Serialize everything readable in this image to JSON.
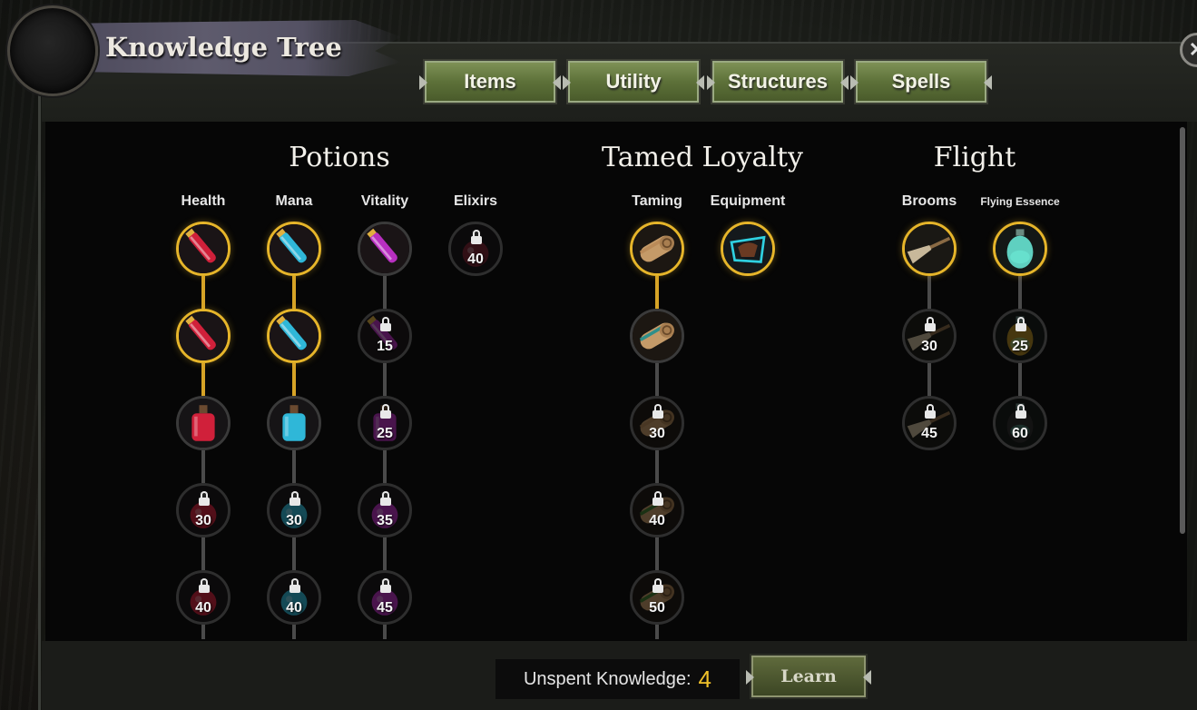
{
  "window": {
    "title": "Knowledge Tree",
    "close_icon": "x-icon"
  },
  "tabs": [
    {
      "label": "Items",
      "active": false
    },
    {
      "label": "Utility",
      "active": false
    },
    {
      "label": "Structures",
      "active": false
    },
    {
      "label": "Spells",
      "active": false
    }
  ],
  "categories": [
    {
      "title": "Potions",
      "columns": [
        {
          "label": "Health",
          "nodes": [
            {
              "icon": "health-potion-large-icon",
              "state": "unlocked",
              "level": ""
            },
            {
              "icon": "health-potion-vial-icon",
              "state": "unlocked",
              "level": ""
            },
            {
              "icon": "health-potion-bottle-icon",
              "state": "learnable",
              "level": ""
            },
            {
              "icon": "health-potion-round-icon",
              "state": "locked",
              "level": "30"
            },
            {
              "icon": "health-potion-flask-icon",
              "state": "locked",
              "level": "40"
            }
          ]
        },
        {
          "label": "Mana",
          "nodes": [
            {
              "icon": "mana-potion-large-icon",
              "state": "unlocked",
              "level": ""
            },
            {
              "icon": "mana-potion-vial-icon",
              "state": "unlocked",
              "level": ""
            },
            {
              "icon": "mana-potion-bottle-icon",
              "state": "learnable",
              "level": ""
            },
            {
              "icon": "mana-potion-round-icon",
              "state": "locked",
              "level": "30"
            },
            {
              "icon": "mana-potion-flask-icon",
              "state": "locked",
              "level": "40"
            }
          ]
        },
        {
          "label": "Vitality",
          "nodes": [
            {
              "icon": "vitality-potion-large-icon",
              "state": "learnable",
              "level": ""
            },
            {
              "icon": "vitality-potion-vial-icon",
              "state": "locked",
              "level": "15"
            },
            {
              "icon": "vitality-potion-bottle-icon",
              "state": "locked",
              "level": "25"
            },
            {
              "icon": "vitality-potion-round-icon",
              "state": "locked",
              "level": "35"
            },
            {
              "icon": "vitality-potion-flask-icon",
              "state": "locked",
              "level": "45"
            }
          ]
        },
        {
          "label": "Elixirs",
          "nodes": [
            {
              "icon": "elixir-flask-icon",
              "state": "locked",
              "level": "40"
            }
          ]
        }
      ]
    },
    {
      "title": "Tamed Loyalty",
      "columns": [
        {
          "label": "Taming",
          "nodes": [
            {
              "icon": "taming-scroll-icon",
              "state": "unlocked",
              "level": ""
            },
            {
              "icon": "taming-scroll-teal-icon",
              "state": "learnable",
              "level": ""
            },
            {
              "icon": "taming-scroll-icon",
              "state": "locked",
              "level": "30"
            },
            {
              "icon": "taming-scroll-green-icon",
              "state": "locked",
              "level": "40"
            },
            {
              "icon": "taming-scroll-green-icon",
              "state": "locked",
              "level": "50"
            }
          ]
        },
        {
          "label": "Equipment",
          "nodes": [
            {
              "icon": "saddle-icon",
              "state": "unlocked",
              "level": ""
            }
          ]
        }
      ]
    },
    {
      "title": "Flight",
      "columns": [
        {
          "label": "Brooms",
          "nodes": [
            {
              "icon": "broom-icon",
              "state": "unlocked",
              "level": ""
            },
            {
              "icon": "broom-icon",
              "state": "locked",
              "level": "30"
            },
            {
              "icon": "broom-icon",
              "state": "locked",
              "level": "45"
            }
          ]
        },
        {
          "label": "Flying Essence",
          "nodes": [
            {
              "icon": "flying-essence-jar-icon",
              "state": "unlocked",
              "level": ""
            },
            {
              "icon": "flying-essence-gold-icon",
              "state": "locked",
              "level": "25"
            },
            {
              "icon": "flying-essence-dark-icon",
              "state": "locked",
              "level": "60"
            }
          ]
        }
      ]
    }
  ],
  "footer": {
    "unspent_label": "Unspent Knowledge:",
    "unspent_value": "4",
    "learn_label": "Learn"
  },
  "colors": {
    "gold": "#e6b52a",
    "tab_green": "#5d7139",
    "counter": "#f0c12a"
  }
}
